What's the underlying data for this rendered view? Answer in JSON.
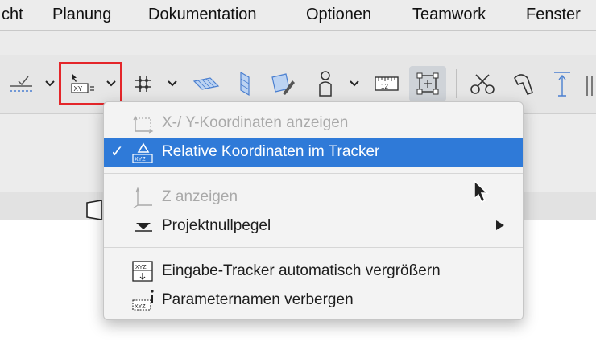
{
  "menubar": {
    "items": [
      {
        "label": "cht"
      },
      {
        "label": "Planung"
      },
      {
        "label": "Dokumentation"
      },
      {
        "label": "Optionen"
      },
      {
        "label": "Teamwork"
      },
      {
        "label": "Fenster"
      }
    ]
  },
  "toolbar": {
    "buttons": [
      "guide-line-icon",
      "coordinates-xy-icon",
      "grid-snap-icon",
      "plane-icon",
      "vertical-plane-icon",
      "edit-plane-icon",
      "figure-icon",
      "ruler-icon",
      "selection-frame-icon",
      "scissors-icon",
      "pick-icon",
      "elevation-icon"
    ],
    "highlight_color": "#e4262a"
  },
  "dropdown": {
    "items": [
      {
        "label": "X-/ Y-Koordinaten anzeigen",
        "enabled": false,
        "checked": false,
        "icon": "xy-coordinates-icon"
      },
      {
        "label": "Relative Koordinaten im Tracker",
        "enabled": true,
        "checked": true,
        "selected": true,
        "icon": "relative-coordinates-icon"
      },
      {
        "label": "Z anzeigen",
        "enabled": false,
        "checked": false,
        "icon": "z-axis-icon"
      },
      {
        "label": "Projektnullpegel",
        "enabled": true,
        "checked": false,
        "submenu": true,
        "icon": "zero-level-icon"
      },
      {
        "label": "Eingabe-Tracker automatisch vergrößern",
        "enabled": true,
        "checked": false,
        "icon": "tracker-enlarge-icon"
      },
      {
        "label": "Parameternamen verbergen",
        "enabled": true,
        "checked": false,
        "icon": "hide-parameter-names-icon"
      }
    ],
    "check_mark": "✓",
    "selection_color": "#2f7ad8"
  }
}
